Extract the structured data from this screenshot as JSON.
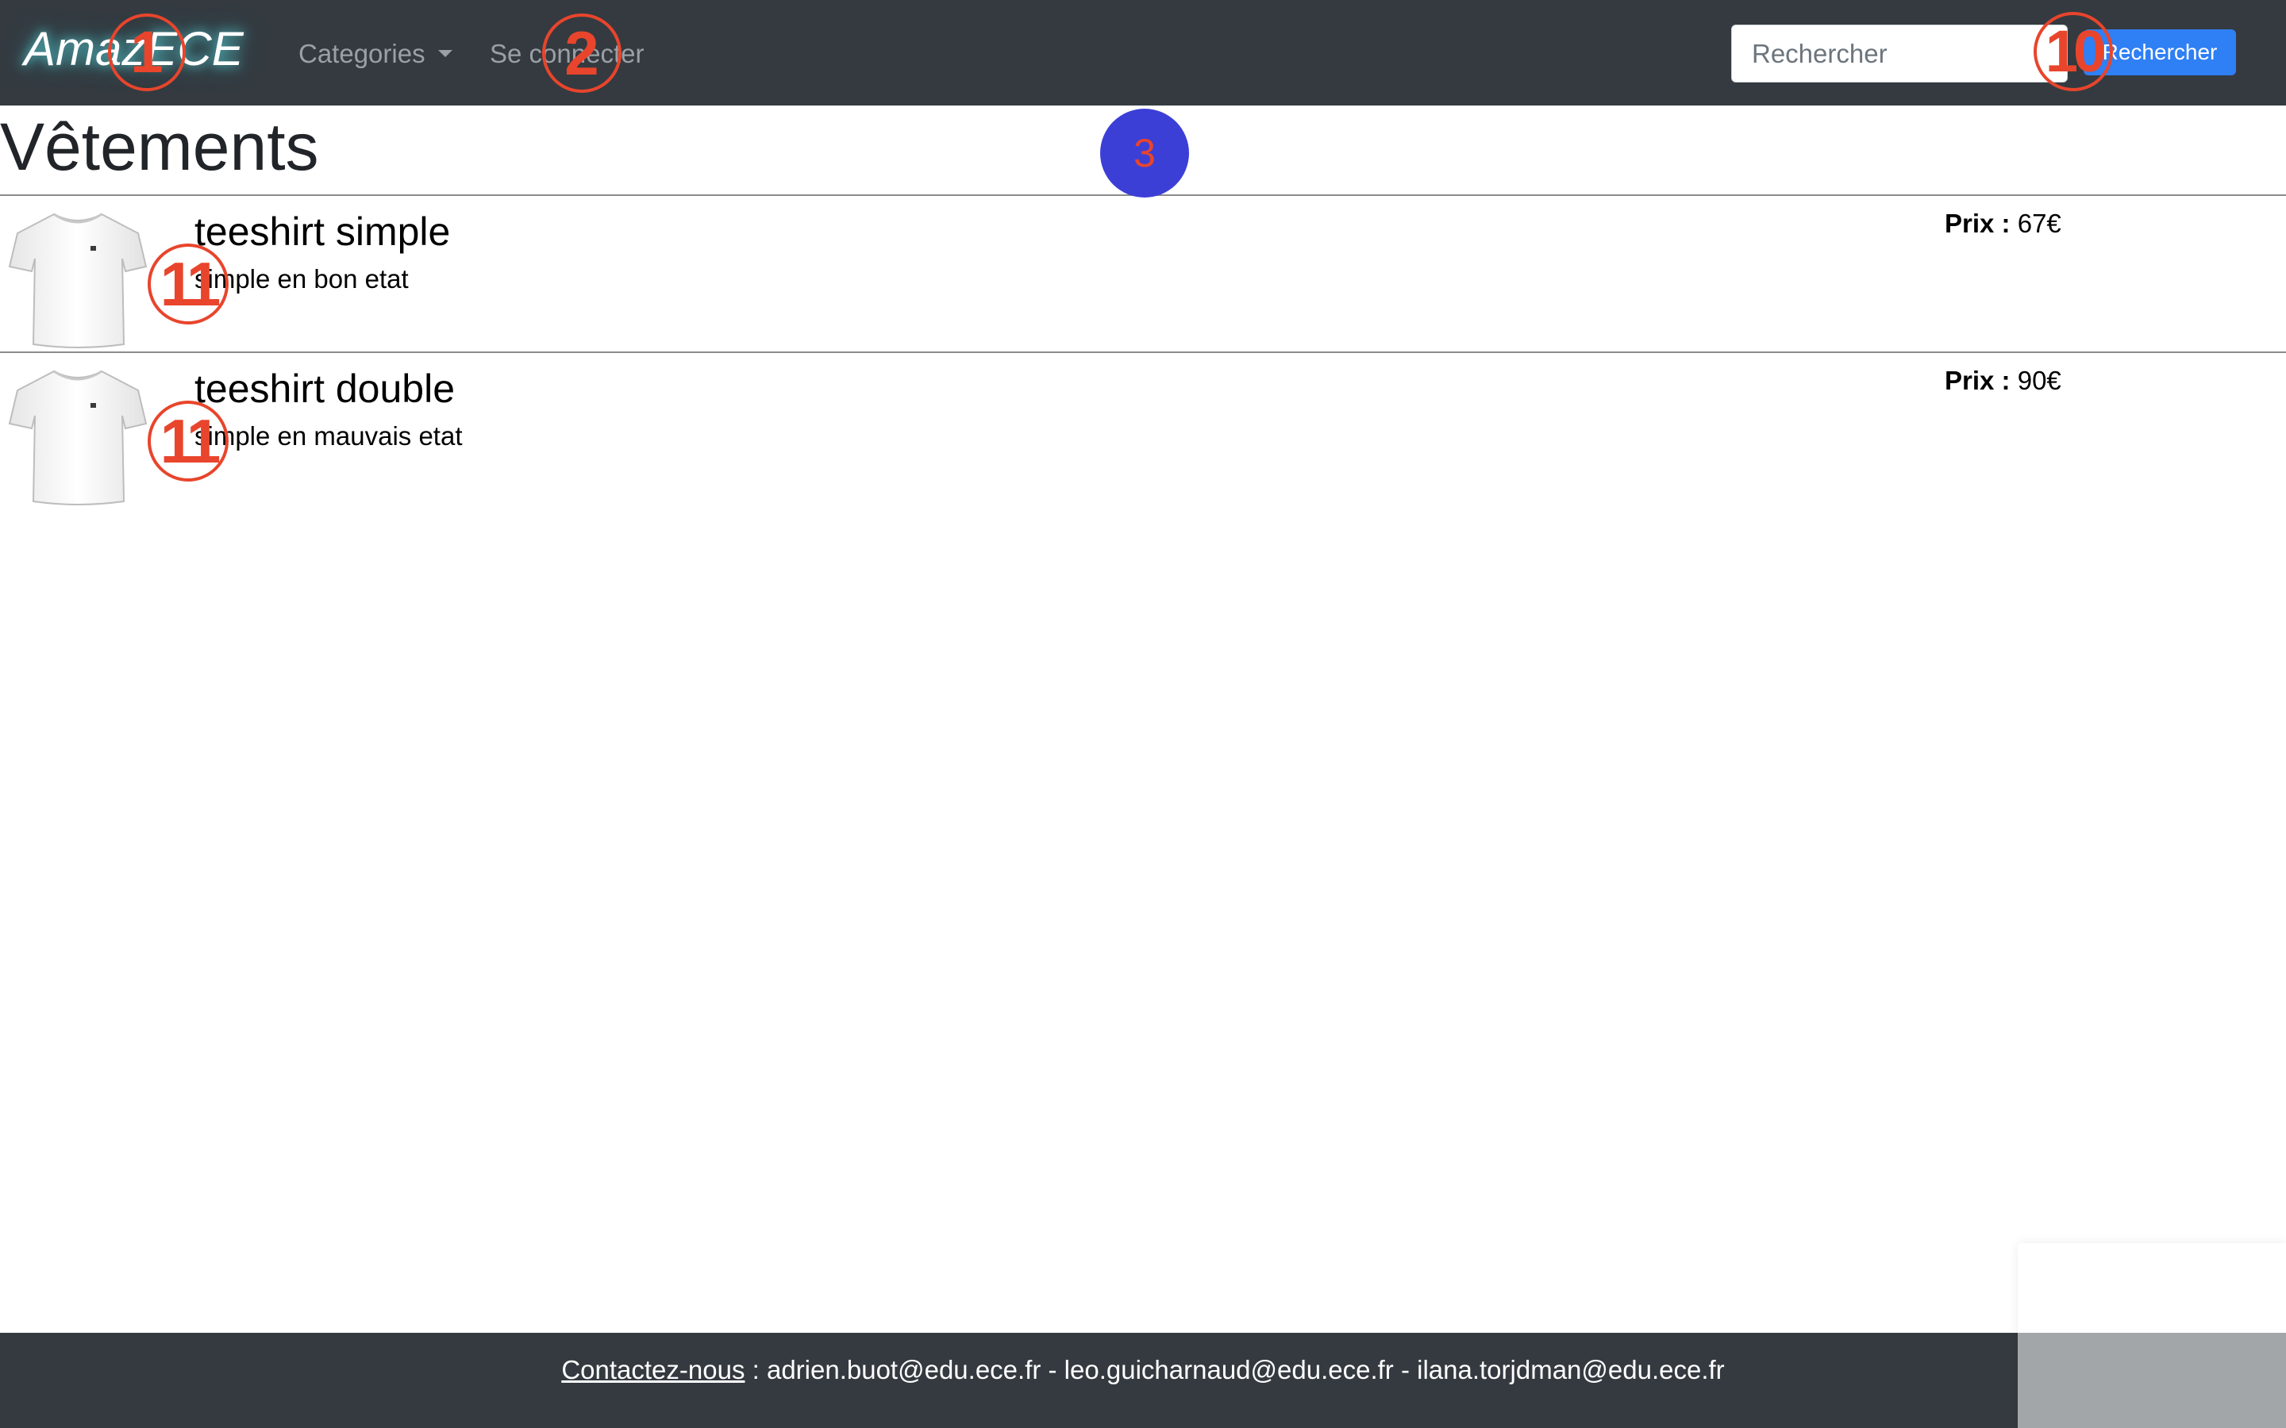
{
  "navbar": {
    "brand": "AmazECE",
    "categories_label": "Categories",
    "login_label": "Se connecter",
    "search_placeholder": "Rechercher",
    "search_button_label": "Rechercher"
  },
  "markers": {
    "m1": "1",
    "m2": "2",
    "m3": "3",
    "m10": "10",
    "m11a": "11",
    "m11b": "11"
  },
  "page": {
    "title": "Vêtements"
  },
  "products": [
    {
      "name": "teeshirt simple",
      "description": "simple en bon etat",
      "price_label": "Prix :",
      "price": "67€"
    },
    {
      "name": "teeshirt double",
      "description": "simple en mauvais etat",
      "price_label": "Prix :",
      "price": "90€"
    }
  ],
  "footer": {
    "contact_link": "Contactez-nous",
    "separator": " : ",
    "emails": "adrien.buot@edu.ece.fr - leo.guicharnaud@edu.ece.fr - ilana.torjdman@edu.ece.fr"
  },
  "colors": {
    "navbar_bg": "#343a40",
    "search_button": "#2f7ff5",
    "marker_red": "#e8452c",
    "marker_blue": "#3c3fd6"
  }
}
